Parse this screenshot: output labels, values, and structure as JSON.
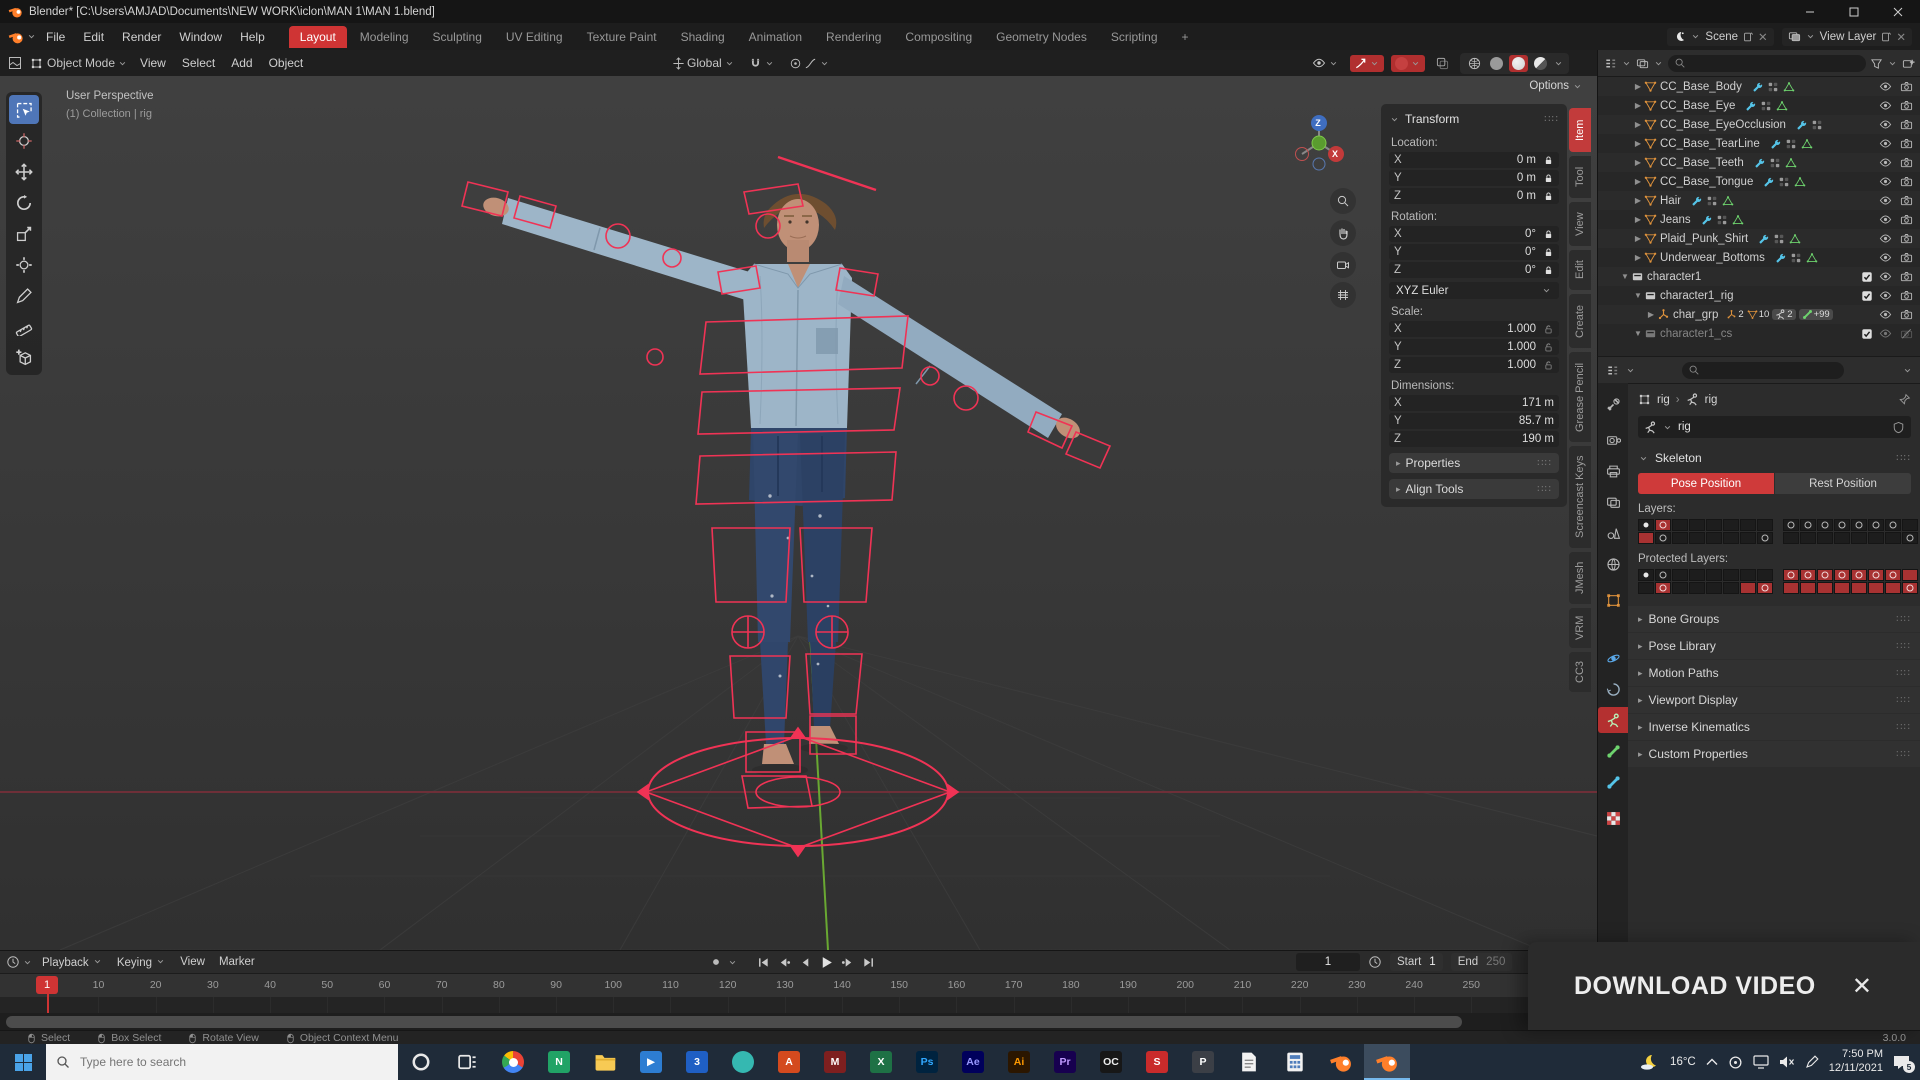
{
  "window": {
    "title": "Blender* [C:\\Users\\AMJAD\\Documents\\NEW WORK\\iclon\\MAN 1\\MAN 1.blend]"
  },
  "menubar": {
    "menus": [
      "File",
      "Edit",
      "Render",
      "Window",
      "Help"
    ],
    "workspaces": [
      "Layout",
      "Modeling",
      "Sculpting",
      "UV Editing",
      "Texture Paint",
      "Shading",
      "Animation",
      "Rendering",
      "Compositing",
      "Geometry Nodes",
      "Scripting"
    ],
    "active_workspace": "Layout",
    "new_tab": "+",
    "scene_label": "Scene",
    "view_layer_label": "View Layer"
  },
  "viewport_header": {
    "mode": "Object Mode",
    "menus": [
      "View",
      "Select",
      "Add",
      "Object"
    ],
    "orientation": "Global"
  },
  "tools": [
    "select-box",
    "cursor",
    "move",
    "rotate",
    "scale",
    "transform",
    "annotate",
    "measure",
    "add-cube"
  ],
  "viewport": {
    "view_label": "User Perspective",
    "context_label": "(1) Collection | rig",
    "options_label": "Options",
    "gizmo_z": "Z",
    "gizmo_x": "X"
  },
  "sidebar_tabs": {
    "active": "Item",
    "tabs": [
      "Item",
      "Tool",
      "View",
      "Edit",
      "Create",
      "Grease Pencil",
      "Screencast Keys",
      "JMesh",
      "VRM",
      "CC3"
    ]
  },
  "transform": {
    "title": "Transform",
    "groups": [
      {
        "label": "Location:",
        "lock": "closed",
        "rows": [
          [
            "X",
            "0 m"
          ],
          [
            "Y",
            "0 m"
          ],
          [
            "Z",
            "0 m"
          ]
        ]
      },
      {
        "label": "Rotation:",
        "lock": "closed",
        "rows": [
          [
            "X",
            "0°"
          ],
          [
            "Y",
            "0°"
          ],
          [
            "Z",
            "0°"
          ]
        ],
        "extra": "XYZ Euler"
      },
      {
        "label": "Scale:",
        "lock": "open",
        "rows": [
          [
            "X",
            "1.000"
          ],
          [
            "Y",
            "1.000"
          ],
          [
            "Z",
            "1.000"
          ]
        ]
      },
      {
        "label": "Dimensions:",
        "lock": "none",
        "rows": [
          [
            "X",
            "171 m"
          ],
          [
            "Y",
            "85.7 m"
          ],
          [
            "Z",
            "190 m"
          ]
        ]
      }
    ],
    "sections": [
      "Properties",
      "Align Tools"
    ]
  },
  "outliner": {
    "rows": [
      {
        "name": "CC_Base_Body",
        "type": "mesh",
        "indent": 2,
        "disc": "r",
        "tr": [
          "wrench",
          "mod",
          "meshdata"
        ],
        "right": [
          "eye",
          "cam"
        ]
      },
      {
        "name": "CC_Base_Eye",
        "type": "mesh",
        "indent": 2,
        "disc": "r",
        "tr": [
          "wrench",
          "mod",
          "meshdata"
        ],
        "right": [
          "eye",
          "cam"
        ]
      },
      {
        "name": "CC_Base_EyeOcclusion",
        "type": "mesh",
        "indent": 2,
        "disc": "r",
        "tr": [
          "wrench",
          "mod"
        ],
        "right": [
          "eye",
          "cam"
        ]
      },
      {
        "name": "CC_Base_TearLine",
        "type": "mesh",
        "indent": 2,
        "disc": "r",
        "tr": [
          "wrench",
          "mod",
          "meshdata"
        ],
        "right": [
          "eye",
          "cam"
        ]
      },
      {
        "name": "CC_Base_Teeth",
        "type": "mesh",
        "indent": 2,
        "disc": "r",
        "tr": [
          "wrench",
          "mod",
          "meshdata"
        ],
        "right": [
          "eye",
          "cam"
        ]
      },
      {
        "name": "CC_Base_Tongue",
        "type": "mesh",
        "indent": 2,
        "disc": "r",
        "tr": [
          "wrench",
          "mod",
          "meshdata"
        ],
        "right": [
          "eye",
          "cam"
        ]
      },
      {
        "name": "Hair",
        "type": "mesh",
        "indent": 2,
        "disc": "r",
        "tr": [
          "wrench",
          "mod",
          "meshdata"
        ],
        "right": [
          "eye",
          "cam"
        ]
      },
      {
        "name": "Jeans",
        "type": "mesh",
        "indent": 2,
        "disc": "r",
        "tr": [
          "wrench",
          "mod",
          "meshdata"
        ],
        "right": [
          "eye",
          "cam"
        ]
      },
      {
        "name": "Plaid_Punk_Shirt",
        "type": "mesh",
        "indent": 2,
        "disc": "r",
        "tr": [
          "wrench",
          "mod",
          "meshdata"
        ],
        "right": [
          "eye",
          "cam"
        ]
      },
      {
        "name": "Underwear_Bottoms",
        "type": "mesh",
        "indent": 2,
        "disc": "r",
        "tr": [
          "wrench",
          "mod",
          "meshdata"
        ],
        "right": [
          "eye",
          "cam"
        ]
      },
      {
        "name": "character1",
        "type": "collection",
        "indent": 1,
        "disc": "d",
        "check": true,
        "right": [
          "eye",
          "cam"
        ]
      },
      {
        "name": "character1_rig",
        "type": "collection",
        "indent": 2,
        "disc": "d",
        "check": true,
        "right": [
          "eye",
          "cam"
        ]
      },
      {
        "name": "char_grp",
        "type": "empty",
        "indent": 3,
        "disc": "r",
        "counts": [
          [
            "empty",
            "2"
          ],
          [
            "mesh",
            "10"
          ],
          [
            "armature",
            "2"
          ],
          [
            "bone",
            "+99"
          ]
        ],
        "right": [
          "eye",
          "cam"
        ]
      },
      {
        "name": "character1_cs",
        "type": "collection",
        "indent": 2,
        "disc": "d",
        "check": true,
        "dim": true,
        "right": [
          "eye",
          "camx"
        ]
      }
    ]
  },
  "properties": {
    "breadcrumb_object": "rig",
    "breadcrumb_data": "rig",
    "object_name": "rig",
    "skeleton": {
      "title": "Skeleton",
      "pose": "Pose Position",
      "rest": "Rest Position",
      "layers_label": "Layers:",
      "protected_label": "Protected Layers:",
      "layers_left": [
        [
          "D",
          "RO",
          "E",
          "E",
          "E",
          "E",
          "E",
          "E"
        ],
        [
          "R",
          "O",
          "E",
          "E",
          "E",
          "E",
          "E",
          "O"
        ]
      ],
      "layers_right": [
        [
          "O",
          "O",
          "O",
          "O",
          "O",
          "O",
          "O",
          "E"
        ],
        [
          "E",
          "E",
          "E",
          "E",
          "E",
          "E",
          "E",
          "O"
        ]
      ],
      "protected_left": [
        [
          "D",
          "O",
          "E",
          "E",
          "E",
          "E",
          "E",
          "E"
        ],
        [
          "E",
          "RO",
          "E",
          "E",
          "E",
          "E",
          "R",
          "RO"
        ]
      ],
      "protected_right": [
        [
          "RO",
          "RO",
          "RO",
          "RO",
          "RO",
          "RO",
          "RO",
          "R"
        ],
        [
          "R",
          "R",
          "R",
          "R",
          "R",
          "R",
          "R",
          "RO"
        ]
      ]
    },
    "sections": [
      "Bone Groups",
      "Pose Library",
      "Motion Paths",
      "Viewport Display",
      "Inverse Kinematics",
      "Custom Properties"
    ]
  },
  "timeline": {
    "menus": [
      "Playback",
      "Keying",
      "View",
      "Marker"
    ],
    "current_frame": "1",
    "frame_field": "1",
    "start_label": "Start",
    "start_value": "1",
    "end_label": "End",
    "end_value": "250",
    "tick_step": 10,
    "tick_end": 250
  },
  "statusbar": {
    "items": [
      "Select",
      "Box Select",
      "Rotate View",
      "Object Context Menu"
    ],
    "version": "3.0.0"
  },
  "download_overlay": {
    "text": "DOWNLOAD VIDEO",
    "close": "✕"
  },
  "taskbar": {
    "search_placeholder": "Type here to search",
    "apps": [
      {
        "name": "cortana",
        "kind": "ring"
      },
      {
        "name": "task-view",
        "kind": "taskview"
      },
      {
        "name": "chrome",
        "kind": "chrome"
      },
      {
        "name": "app-n",
        "kind": "sq",
        "bg": "#21a366",
        "label": "N"
      },
      {
        "name": "file-explorer",
        "kind": "folder"
      },
      {
        "name": "media-app",
        "kind": "sq",
        "bg": "#2d7dd2",
        "label": "▶"
      },
      {
        "name": "app-3",
        "kind": "sq",
        "bg": "#1f5fc4",
        "label": "3"
      },
      {
        "name": "edge",
        "kind": "circle",
        "bg": "#35b8b1"
      },
      {
        "name": "app-a",
        "kind": "sq",
        "bg": "#d44a1e",
        "label": "A"
      },
      {
        "name": "app-m",
        "kind": "sq",
        "bg": "#7e1f1f",
        "label": "M"
      },
      {
        "name": "excel",
        "kind": "sq",
        "bg": "#1e7145",
        "label": "X"
      },
      {
        "name": "photoshop",
        "kind": "sq",
        "bg": "#00233f",
        "label": "Ps",
        "fg": "#31a8ff"
      },
      {
        "name": "after-effects",
        "kind": "sq",
        "bg": "#00005b",
        "label": "Ae",
        "fg": "#9999ff"
      },
      {
        "name": "illustrator",
        "kind": "sq",
        "bg": "#2b1600",
        "label": "Ai",
        "fg": "#ff9a00"
      },
      {
        "name": "premiere",
        "kind": "sq",
        "bg": "#17004f",
        "label": "Pr",
        "fg": "#c09aff"
      },
      {
        "name": "app-oc",
        "kind": "sq",
        "bg": "#171717",
        "label": "OC",
        "fg": "#eeeeee"
      },
      {
        "name": "app-s",
        "kind": "sq",
        "bg": "#c92b2b",
        "label": "S"
      },
      {
        "name": "app-p",
        "kind": "sq",
        "bg": "#3b3f46",
        "label": "P"
      },
      {
        "name": "notepad",
        "kind": "page"
      },
      {
        "name": "calculator",
        "kind": "calc"
      },
      {
        "name": "blender",
        "kind": "blender"
      },
      {
        "name": "blender",
        "kind": "blender",
        "active": true
      }
    ],
    "tray": {
      "temp": "16°C",
      "time": "7:50 PM",
      "date": "12/11/2021",
      "badge": "5"
    }
  }
}
